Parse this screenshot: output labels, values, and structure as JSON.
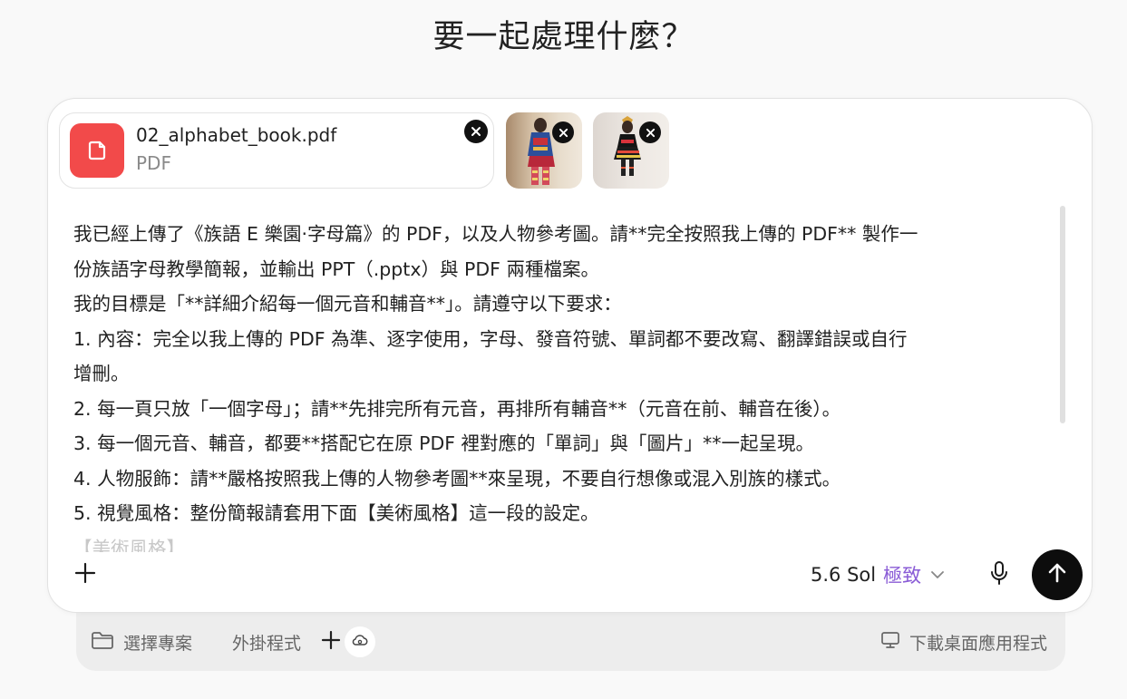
{
  "heading": "要一起處理什麼？",
  "attachments": {
    "file": {
      "name": "02_alphabet_book.pdf",
      "type": "PDF",
      "icon": "file-icon",
      "color": "#f24a4a"
    },
    "images": [
      "image-thumbnail",
      "image-thumbnail"
    ]
  },
  "prompt_lines": [
    "我已經上傳了《族語 E 樂園·字母篇》的 PDF，以及人物參考圖。請**完全按照我上傳的 PDF** 製作一",
    "份族語字母教學簡報，並輸出 PPT（.pptx）與 PDF 兩種檔案。",
    "我的目標是「**詳細介紹每一個元音和輔音**」。請遵守以下要求：",
    "1. 內容：完全以我上傳的 PDF 為準、逐字使用，字母、發音符號、單詞都不要改寫、翻譯錯誤或自行",
    "增刪。",
    "2. 每一頁只放「一個字母」；請**先排完所有元音，再排所有輔音**（元音在前、輔音在後）。",
    "3. 每一個元音、輔音，都要**搭配它在原 PDF 裡對應的「單詞」與「圖片」**一起呈現。",
    "4. 人物服飾：請**嚴格按照我上傳的人物參考圖**來呈現，不要自行想像或混入別族的樣式。",
    "5. 視覺風格：整份簡報請套用下面【美術風格】這一段的設定。",
    "【美術風格】"
  ],
  "toolbar": {
    "model_name": "5.6 Sol",
    "model_mode": "極致",
    "mode_color": "#8a5cd6"
  },
  "footer": {
    "select_project": "選擇專案",
    "plugins": "外掛程式",
    "download_app": "下載桌面應用程式"
  }
}
